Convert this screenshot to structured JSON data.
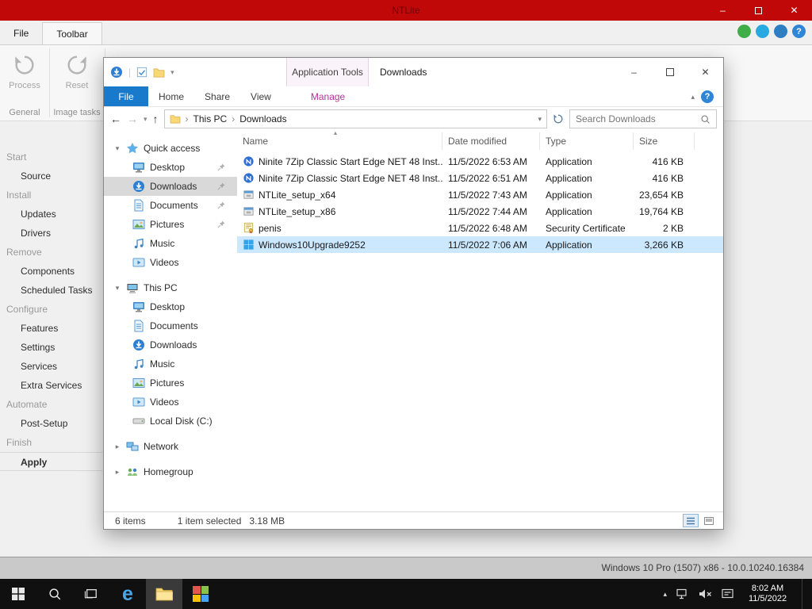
{
  "desktop": {
    "watermark": "Windows 10 Pro (1507) x86 - 10.0.10240.16384"
  },
  "ntlite": {
    "title": "NTLite",
    "menu_tabs": {
      "file": "File",
      "toolbar": "Toolbar"
    },
    "ribbon": {
      "process": "Process",
      "reset": "Reset",
      "group_general": "General",
      "group_image_tasks": "Image tasks"
    },
    "sidebar": [
      {
        "type": "header",
        "label": "Start"
      },
      {
        "type": "item",
        "label": "Source"
      },
      {
        "type": "header",
        "label": "Install"
      },
      {
        "type": "item",
        "label": "Updates"
      },
      {
        "type": "item",
        "label": "Drivers"
      },
      {
        "type": "header",
        "label": "Remove"
      },
      {
        "type": "item",
        "label": "Components"
      },
      {
        "type": "item",
        "label": "Scheduled Tasks"
      },
      {
        "type": "header",
        "label": "Configure"
      },
      {
        "type": "item",
        "label": "Features"
      },
      {
        "type": "item",
        "label": "Settings"
      },
      {
        "type": "item",
        "label": "Services"
      },
      {
        "type": "item",
        "label": "Extra Services"
      },
      {
        "type": "header",
        "label": "Automate"
      },
      {
        "type": "item",
        "label": "Post-Setup"
      },
      {
        "type": "header",
        "label": "Finish"
      },
      {
        "type": "item",
        "label": "Apply"
      }
    ]
  },
  "explorer": {
    "window_title": "Downloads",
    "contextual_tab": "Application Tools",
    "tabs": {
      "file": "File",
      "home": "Home",
      "share": "Share",
      "view": "View",
      "manage": "Manage"
    },
    "address": {
      "root": "This PC",
      "current": "Downloads"
    },
    "search_placeholder": "Search Downloads",
    "nav": {
      "quick_access": {
        "label": "Quick access",
        "icon": "star",
        "items": [
          {
            "label": "Desktop",
            "icon": "desktop",
            "pinned": true
          },
          {
            "label": "Downloads",
            "icon": "downloads",
            "pinned": true,
            "selected": true
          },
          {
            "label": "Documents",
            "icon": "documents",
            "pinned": true
          },
          {
            "label": "Pictures",
            "icon": "pictures",
            "pinned": true
          },
          {
            "label": "Music",
            "icon": "music"
          },
          {
            "label": "Videos",
            "icon": "videos"
          }
        ]
      },
      "this_pc": {
        "label": "This PC",
        "icon": "pc",
        "items": [
          {
            "label": "Desktop",
            "icon": "desktop"
          },
          {
            "label": "Documents",
            "icon": "documents"
          },
          {
            "label": "Downloads",
            "icon": "downloads"
          },
          {
            "label": "Music",
            "icon": "music"
          },
          {
            "label": "Pictures",
            "icon": "pictures"
          },
          {
            "label": "Videos",
            "icon": "videos"
          },
          {
            "label": "Local Disk (C:)",
            "icon": "disk"
          }
        ]
      },
      "network": {
        "label": "Network",
        "icon": "network"
      },
      "homegroup": {
        "label": "Homegroup",
        "icon": "homegroup"
      }
    },
    "columns": {
      "name": "Name",
      "modified": "Date modified",
      "type": "Type",
      "size": "Size"
    },
    "files": [
      {
        "name": "Ninite 7Zip Classic Start Edge NET 48 Inst...",
        "modified": "11/5/2022 6:53 AM",
        "type": "Application",
        "size": "416 KB",
        "icon": "ninite"
      },
      {
        "name": "Ninite 7Zip Classic Start Edge NET 48 Inst...",
        "modified": "11/5/2022 6:51 AM",
        "type": "Application",
        "size": "416 KB",
        "icon": "ninite"
      },
      {
        "name": "NTLite_setup_x64",
        "modified": "11/5/2022 7:43 AM",
        "type": "Application",
        "size": "23,654 KB",
        "icon": "setup"
      },
      {
        "name": "NTLite_setup_x86",
        "modified": "11/5/2022 7:44 AM",
        "type": "Application",
        "size": "19,764 KB",
        "icon": "setup"
      },
      {
        "name": "penis",
        "modified": "11/5/2022 6:48 AM",
        "type": "Security Certificate",
        "size": "2 KB",
        "icon": "certificate"
      },
      {
        "name": "Windows10Upgrade9252",
        "modified": "11/5/2022 7:06 AM",
        "type": "Application",
        "size": "3,266 KB",
        "icon": "windows",
        "selected": true
      }
    ],
    "status": {
      "total": "6 items",
      "selected": "1 item selected",
      "size": "3.18 MB"
    }
  },
  "taskbar": {
    "clock_time": "8:02 AM",
    "clock_date": "11/5/2022"
  }
}
